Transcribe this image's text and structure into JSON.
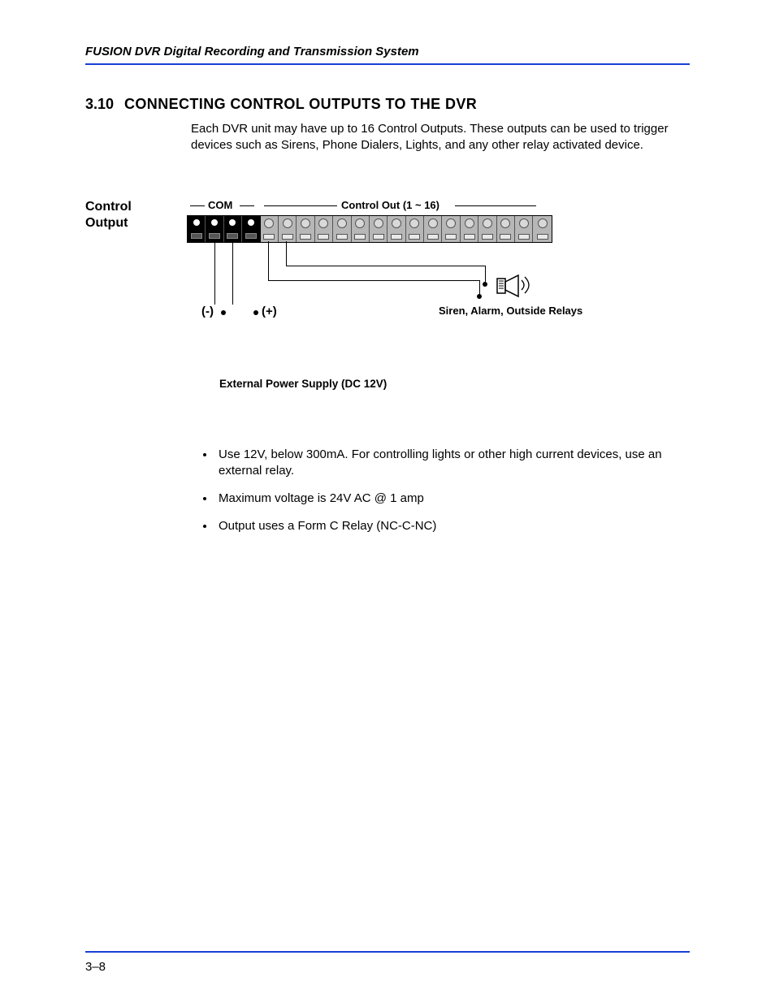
{
  "header": "FUSION DVR Digital Recording and Transmission System",
  "section": {
    "number": "3.10",
    "title": "CONNECTING CONTROL OUTPUTS TO THE DVR",
    "intro": "Each DVR unit may have up to 16 Control Outputs. These outputs can be used to trigger devices such as Sirens, Phone Dialers, Lights, and any other relay activated device."
  },
  "figure": {
    "side_label_l1": "Control",
    "side_label_l2": "Output",
    "com_label": "COM",
    "ctrlout_label": "Control Out (1 ~ 16)",
    "minus": "(-)",
    "plus": "(+)",
    "device_label": "Siren, Alarm, Outside Relays",
    "ps_caption": "External Power Supply (DC 12V)",
    "com_terminals": 4,
    "out_terminals": 16
  },
  "bullets": [
    "Use 12V, below 300mA. For controlling lights or other high current devices, use an external relay.",
    "Maximum voltage is 24V AC @ 1 amp",
    "Output uses a Form C Relay  (NC-C-NC)"
  ],
  "page_number": "3–8"
}
